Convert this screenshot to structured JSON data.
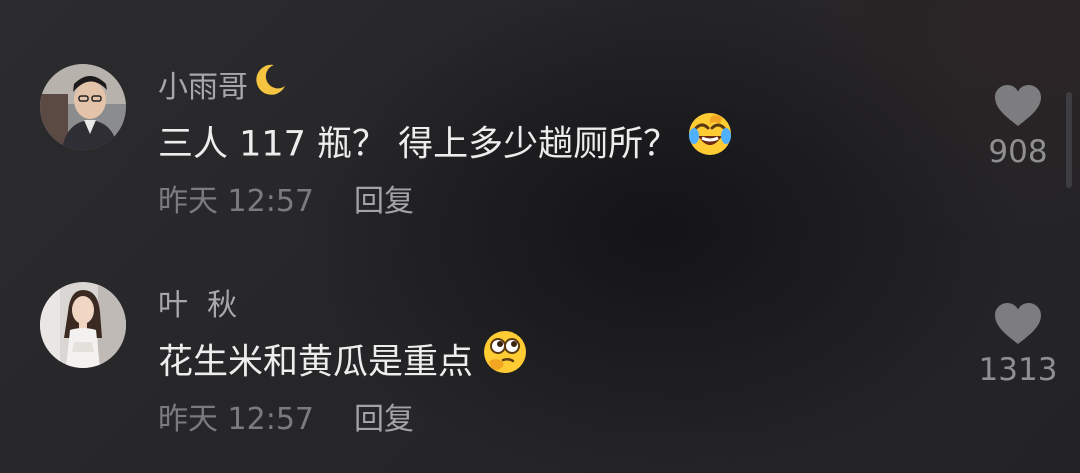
{
  "comments": [
    {
      "username": "小雨哥",
      "username_icon": "crescent-moon-icon",
      "text": "三人 117 瓶？ 得上多少趟厕所？",
      "emoji": "laughing-crying-emoji",
      "time": "昨天 12:57",
      "reply_label": "回复",
      "like_count": "908"
    },
    {
      "username": "叶  秋",
      "text": "花生米和黄瓜是重点",
      "emoji": "thinking-emoji",
      "time": "昨天 12:57",
      "reply_label": "回复",
      "like_count": "1313"
    }
  ],
  "colors": {
    "background": "#272729",
    "username": "#a8a8aa",
    "body_text": "#ededed",
    "time": "#7b7b7e",
    "reply": "#a3a3a5",
    "heart": "#7d7d80",
    "like_count": "#8f8f91",
    "moon": "#f5c542"
  }
}
